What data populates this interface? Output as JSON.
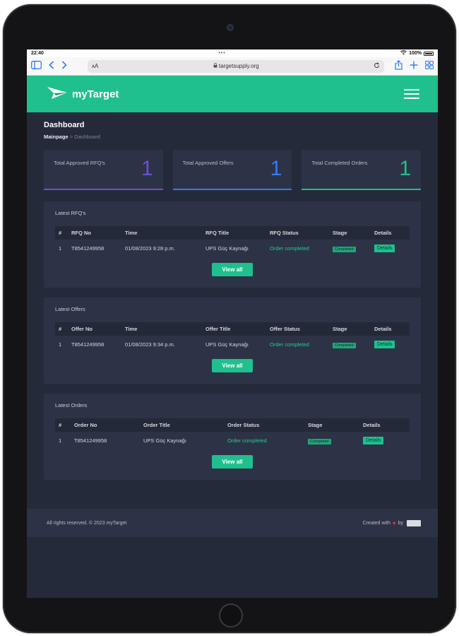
{
  "status_bar": {
    "time": "22:40",
    "dots": "•••",
    "battery": "100%"
  },
  "browser": {
    "aa": "ᴀA",
    "url": "targetsupply.org"
  },
  "app": {
    "brand": "myTarget",
    "accent": "#1fc08e"
  },
  "page": {
    "title": "Dashboard",
    "breadcrumb_home": "Mainpage",
    "breadcrumb_sep": ">",
    "breadcrumb_current": "Dashboard"
  },
  "stats": [
    {
      "label": "Total Approved RFQ's",
      "value": "1",
      "color": "#6b4fd8"
    },
    {
      "label": "Total Approved Offers",
      "value": "1",
      "color": "#2f7cf6"
    },
    {
      "label": "Total Completed Orders",
      "value": "1",
      "color": "#1fc08e"
    }
  ],
  "rfqs": {
    "title": "Latest RFQ's",
    "headers": [
      "#",
      "RFQ No",
      "Time",
      "RFQ Title",
      "RFQ Status",
      "Stage",
      "Details"
    ],
    "rows": [
      {
        "num": "1",
        "no": "T8541249958",
        "time": "01/08/2023 9:28 p.m.",
        "title": "UPS Güç Kaynağı",
        "status": "Order completed",
        "stage": "Completed",
        "details": "Details"
      }
    ],
    "view_all": "View all"
  },
  "offers": {
    "title": "Latest Offers",
    "headers": [
      "#",
      "Offer No",
      "Time",
      "Offer Title",
      "Offer Status",
      "Stage",
      "Details"
    ],
    "rows": [
      {
        "num": "1",
        "no": "T8541249958",
        "time": "01/08/2023 9:34 p.m.",
        "title": "UPS Güç Kaynağı",
        "status": "Order completed",
        "stage": "Completed",
        "details": "Details"
      }
    ],
    "view_all": "View all"
  },
  "orders": {
    "title": "Latest Orders",
    "headers": [
      "#",
      "Order No",
      "Order Title",
      "Order Status",
      "Stage",
      "Details"
    ],
    "rows": [
      {
        "num": "1",
        "no": "T8541249958",
        "title": "UPS Güç Kaynağı",
        "status": "Order completed",
        "stage": "Completed",
        "details": "Details"
      }
    ],
    "view_all": "View all"
  },
  "footer": {
    "copyright": "All rights reserved. © 2023 myTarget",
    "created_with": "Created with",
    "by": "by"
  }
}
